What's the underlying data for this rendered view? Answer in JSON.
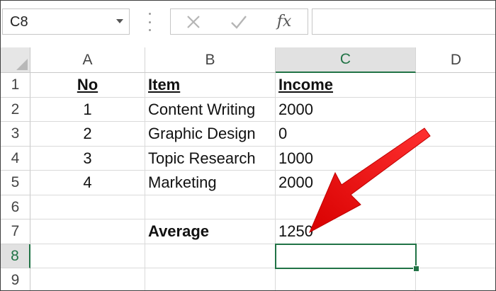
{
  "name_box": {
    "value": "C8"
  },
  "formula_bar": {
    "cancel_icon": "close-icon",
    "enter_icon": "check-icon",
    "fx_label": "fx",
    "value": ""
  },
  "columns": [
    "A",
    "B",
    "C",
    "D"
  ],
  "rows": [
    "1",
    "2",
    "3",
    "4",
    "5",
    "6",
    "7",
    "8",
    "9"
  ],
  "cells": {
    "A1": "No",
    "B1": "Item",
    "C1": "Income",
    "A2": "1",
    "B2": "Content Writing",
    "C2": "2000",
    "A3": "2",
    "B3": "Graphic Design",
    "C3": "0",
    "A4": "3",
    "B4": "Topic Research",
    "C4": "1000",
    "A5": "4",
    "B5": "Marketing",
    "C5": "2000",
    "B7": "Average",
    "C7": "1250"
  },
  "active_cell": "C8",
  "colors": {
    "accent": "#217346",
    "arrow": "#ee1111"
  }
}
